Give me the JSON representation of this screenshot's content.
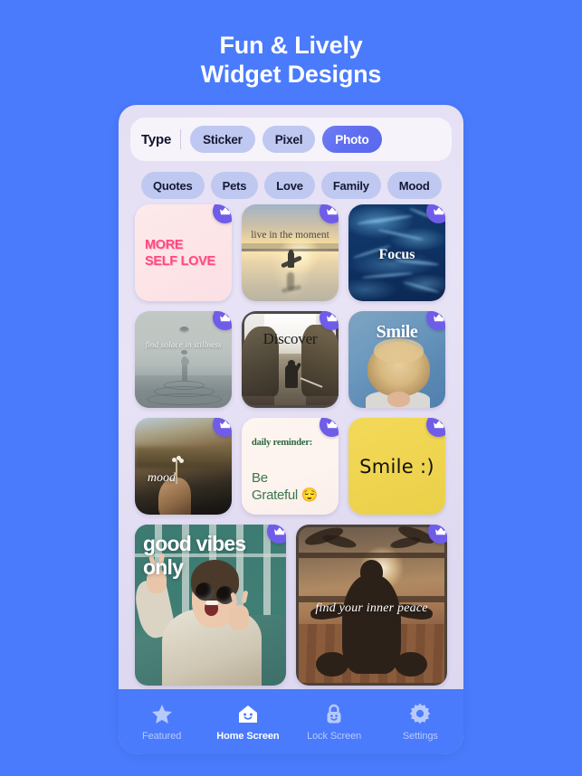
{
  "headline": {
    "line1": "Fun & Lively",
    "line2": "Widget Designs"
  },
  "colors": {
    "page_background": "#4a7bfc",
    "panel_background": "#e6e1f4",
    "chip_idle": "#bfc8f0",
    "chip_selected": "#5f6ef0",
    "crown_badge": "#6f5ce8",
    "tabbar_background": "#4a7bfc",
    "tab_active": "#ffffff",
    "tab_inactive": "#b8c9fb"
  },
  "filters": {
    "type_label": "Type",
    "type_options": [
      {
        "label": "Sticker",
        "selected": false
      },
      {
        "label": "Pixel",
        "selected": false
      },
      {
        "label": "Photo",
        "selected": true
      }
    ],
    "categories": [
      {
        "label": "Quotes"
      },
      {
        "label": "Pets"
      },
      {
        "label": "Love"
      },
      {
        "label": "Family"
      },
      {
        "label": "Mood"
      }
    ]
  },
  "widgets": {
    "badge_icon": "crown-icon",
    "rows": [
      [
        {
          "id": "more-self-love",
          "text": "MORE\nSELF LOVE",
          "style": "pink-text",
          "premium": true
        },
        {
          "id": "live-in-the-moment",
          "text": "live in the moment",
          "style": "surfer-sunset-photo",
          "premium": true
        },
        {
          "id": "focus",
          "text": "Focus",
          "style": "blue-water-photo",
          "premium": true
        }
      ],
      [
        {
          "id": "find-solace-in-stillness",
          "text": "find solace in stillness",
          "style": "water-drop-photo",
          "premium": true
        },
        {
          "id": "discover",
          "text": "Discover",
          "style": "forest-path-photo",
          "premium": true
        },
        {
          "id": "smile",
          "text": "Smile",
          "style": "laughing-woman-photo",
          "premium": true
        }
      ],
      [
        {
          "id": "mood",
          "text": "mood",
          "style": "hand-flower-photo",
          "premium": true
        },
        {
          "id": "be-grateful",
          "title": "daily reminder:",
          "text": "Be\nGrateful 😌",
          "style": "cream-note",
          "premium": true
        },
        {
          "id": "smile-yellow",
          "text": "Smile :)",
          "style": "yellow-note",
          "premium": true
        }
      ]
    ],
    "wide_row": [
      {
        "id": "good-vibes-only",
        "text": "good vibes only",
        "style": "peace-sign-woman-photo",
        "premium": true
      },
      {
        "id": "find-your-inner-peace",
        "text": "find your inner peace",
        "style": "meditation-sunset-photo",
        "premium": true
      }
    ]
  },
  "tabbar": {
    "items": [
      {
        "label": "Featured",
        "icon": "star-icon",
        "active": false
      },
      {
        "label": "Home Screen",
        "icon": "house-smile-icon",
        "active": true
      },
      {
        "label": "Lock Screen",
        "icon": "lock-smile-icon",
        "active": false
      },
      {
        "label": "Settings",
        "icon": "gear-icon",
        "active": false
      }
    ]
  }
}
